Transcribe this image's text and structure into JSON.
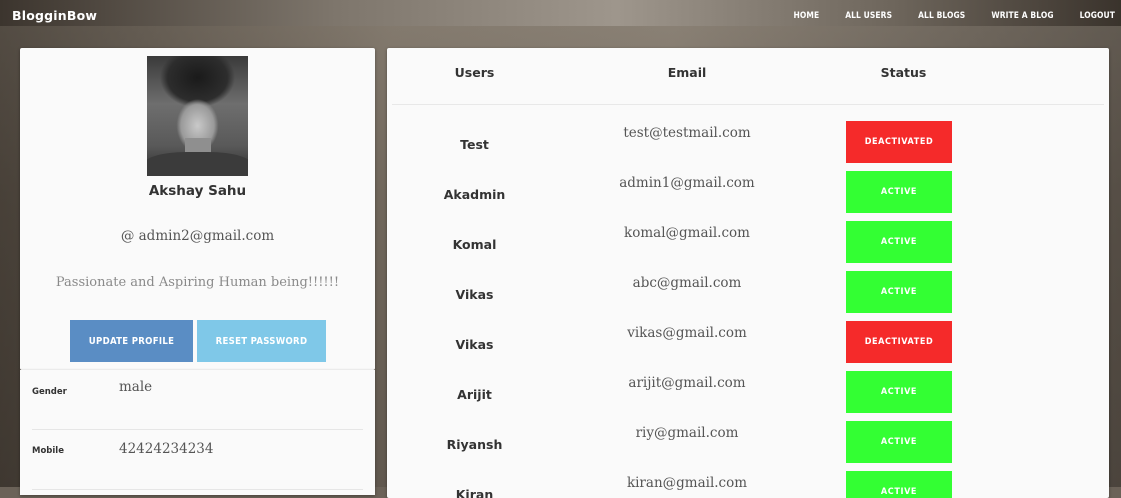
{
  "app": {
    "brand": "BlogginBow"
  },
  "nav": {
    "home": "HOME",
    "all_users": "ALL USERS",
    "all_blogs": "ALL BLOGS",
    "write_blog": "WRITE A BLOG",
    "logout": "LOGOUT"
  },
  "profile": {
    "name": "Akshay Sahu",
    "email": "@ admin2@gmail.com",
    "bio": "Passionate and Aspiring Human being!!!!!!",
    "update_label": "UPDATE PROFILE",
    "reset_label": "RESET PASSWORD",
    "details": [
      {
        "label": "Gender",
        "value": "male"
      },
      {
        "label": "Mobile",
        "value": "42424234234"
      }
    ]
  },
  "table": {
    "headers": {
      "users": "Users",
      "email": "Email",
      "status": "Status"
    },
    "rows": [
      {
        "user": "Test",
        "email": "test@testmail.com",
        "status": "DEACTIVATED"
      },
      {
        "user": "Akadmin",
        "email": "admin1@gmail.com",
        "status": "ACTIVE"
      },
      {
        "user": "Komal",
        "email": "komal@gmail.com",
        "status": "ACTIVE"
      },
      {
        "user": "Vikas",
        "email": "abc@gmail.com",
        "status": "ACTIVE"
      },
      {
        "user": "Vikas",
        "email": "vikas@gmail.com",
        "status": "DEACTIVATED"
      },
      {
        "user": "Arijit",
        "email": "arijit@gmail.com",
        "status": "ACTIVE"
      },
      {
        "user": "Riyansh",
        "email": "riy@gmail.com",
        "status": "ACTIVE"
      },
      {
        "user": "Kiran",
        "email": "kiran@gmail.com",
        "status": "ACTIVE"
      }
    ]
  },
  "colors": {
    "active": "#33ff33",
    "deactivated": "#f52a2a",
    "update_button": "#5a8dc4",
    "reset_button": "#7fc8e8"
  }
}
